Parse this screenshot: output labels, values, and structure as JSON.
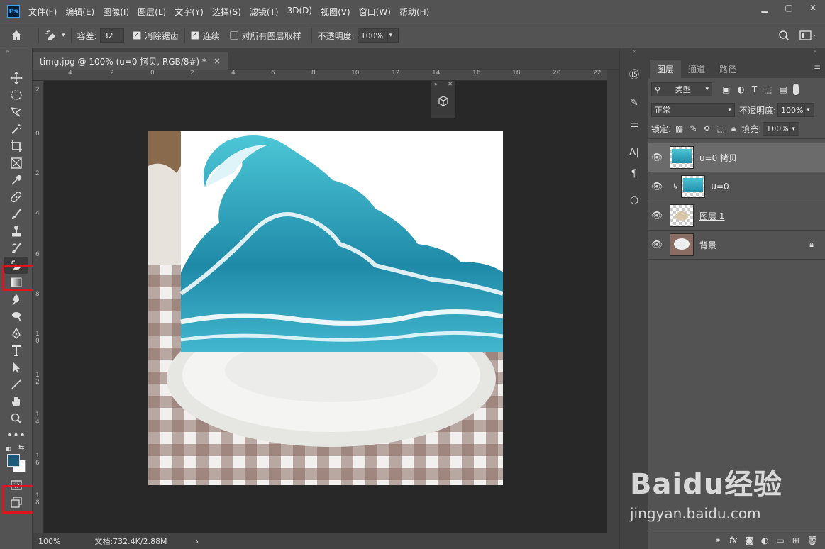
{
  "app": {
    "logo": "Ps"
  },
  "menu": [
    "文件(F)",
    "编辑(E)",
    "图像(I)",
    "图层(L)",
    "文字(Y)",
    "选择(S)",
    "滤镜(T)",
    "3D(D)",
    "视图(V)",
    "窗口(W)",
    "帮助(H)"
  ],
  "options": {
    "tolerance_label": "容差:",
    "tolerance_value": "32",
    "antialias_label": "消除锯齿",
    "contiguous_label": "连续",
    "sample_all_label": "对所有图层取样",
    "opacity_label": "不透明度:",
    "opacity_value": "100%"
  },
  "document": {
    "tab_title": "timg.jpg @ 100% (u=0 拷贝, RGB/8#) *",
    "close": "×"
  },
  "ruler": {
    "top": [
      "4",
      "2",
      "0",
      "2",
      "4",
      "6",
      "8",
      "10",
      "12",
      "14",
      "16",
      "18",
      "20",
      "22"
    ],
    "left": [
      "2",
      "0",
      "2",
      "4",
      "6",
      "8",
      "1\n0",
      "1\n2",
      "1\n4",
      "1\n6",
      "1\n8"
    ]
  },
  "status": {
    "zoom": "100%",
    "doc_info": "文档:732.4K/2.88M",
    "arrow": "›"
  },
  "layers_panel": {
    "tabs": [
      "图层",
      "通道",
      "路径"
    ],
    "filter_label": "类型",
    "blend_mode": "正常",
    "opacity_label": "不透明度:",
    "opacity_value": "100%",
    "lock_label": "锁定:",
    "fill_label": "填充:",
    "fill_value": "100%",
    "layers": [
      {
        "name": "u=0 拷贝",
        "selected": true
      },
      {
        "name": "u=0",
        "selected": false,
        "clipped": true
      },
      {
        "name": "图层 1",
        "selected": false
      },
      {
        "name": "背景",
        "selected": false,
        "locked": true
      }
    ]
  },
  "colors": {
    "foreground": "#1e5a7a",
    "background": "#ffffff",
    "highlight": "#e0141e"
  },
  "watermark": {
    "line1": "Baidu经验",
    "line2": "jingyan.baidu.com"
  }
}
